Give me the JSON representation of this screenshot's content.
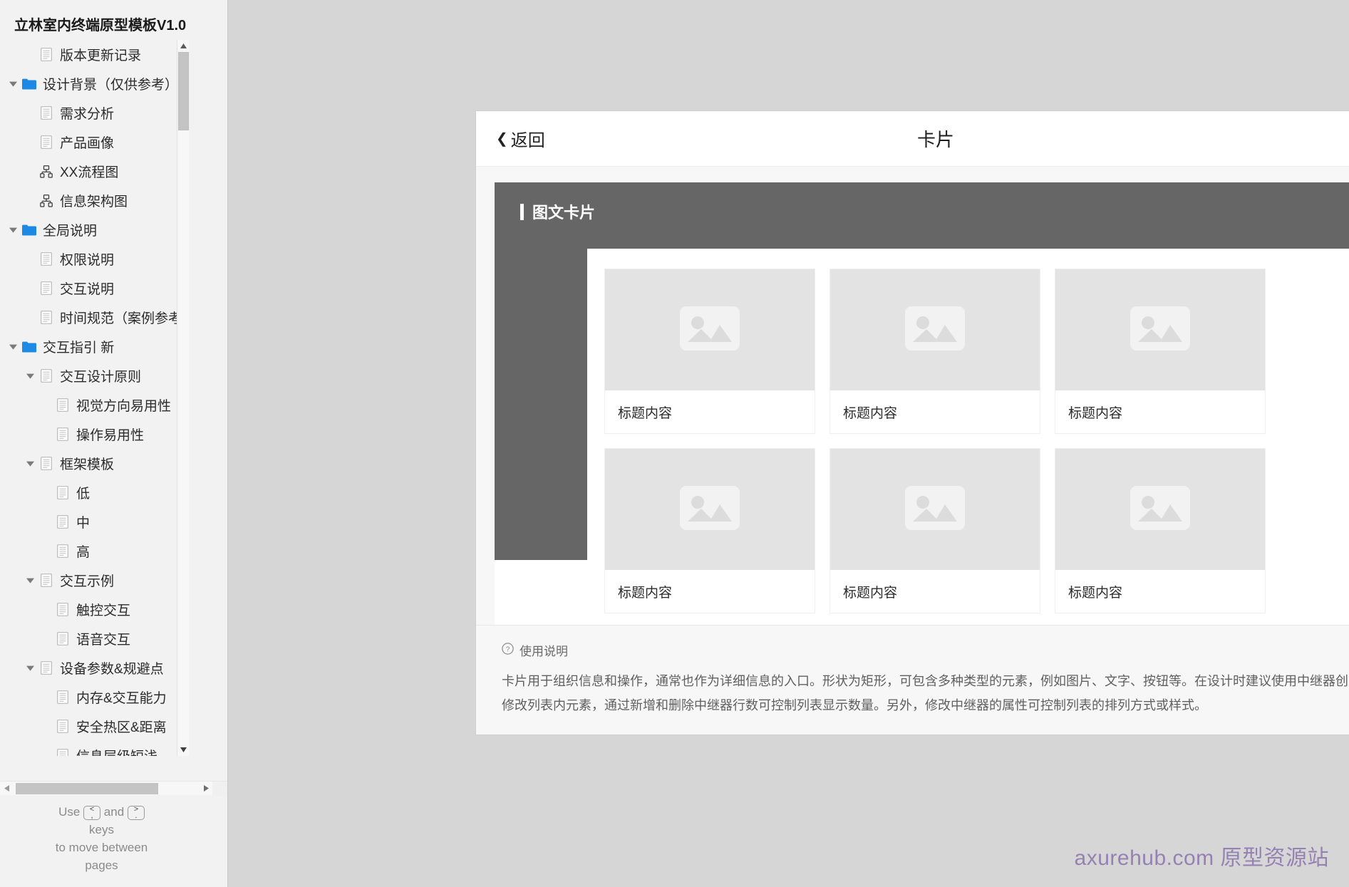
{
  "sidebar": {
    "title": "立林室内终端原型模板V1.0",
    "tree": [
      {
        "level": 1,
        "icon": "page-icon",
        "caret": "none",
        "label": "版本更新记录"
      },
      {
        "level": 0,
        "icon": "folder-icon",
        "caret": "expanded",
        "label": "设计背景（仅供参考）"
      },
      {
        "level": 1,
        "icon": "page-icon",
        "caret": "none",
        "label": "需求分析"
      },
      {
        "level": 1,
        "icon": "page-icon",
        "caret": "none",
        "label": "产品画像"
      },
      {
        "level": 1,
        "icon": "flow-icon",
        "caret": "none",
        "label": "XX流程图"
      },
      {
        "level": 1,
        "icon": "flow-icon",
        "caret": "none",
        "label": "信息架构图"
      },
      {
        "level": 0,
        "icon": "folder-icon",
        "caret": "expanded",
        "label": "全局说明"
      },
      {
        "level": 1,
        "icon": "page-icon",
        "caret": "none",
        "label": "权限说明"
      },
      {
        "level": 1,
        "icon": "page-icon",
        "caret": "none",
        "label": "交互说明"
      },
      {
        "level": 1,
        "icon": "page-icon",
        "caret": "none",
        "label": "时间规范（案例参考）"
      },
      {
        "level": 0,
        "icon": "folder-icon",
        "caret": "expanded",
        "label": "交互指引 新"
      },
      {
        "level": 1,
        "icon": "page-icon",
        "caret": "expanded",
        "label": "交互设计原则"
      },
      {
        "level": 2,
        "icon": "page-icon",
        "caret": "none",
        "label": "视觉方向易用性"
      },
      {
        "level": 2,
        "icon": "page-icon",
        "caret": "none",
        "label": "操作易用性"
      },
      {
        "level": 1,
        "icon": "page-icon",
        "caret": "expanded",
        "label": "框架模板"
      },
      {
        "level": 2,
        "icon": "page-icon",
        "caret": "none",
        "label": "低"
      },
      {
        "level": 2,
        "icon": "page-icon",
        "caret": "none",
        "label": "中"
      },
      {
        "level": 2,
        "icon": "page-icon",
        "caret": "none",
        "label": "高"
      },
      {
        "level": 1,
        "icon": "page-icon",
        "caret": "expanded",
        "label": "交互示例"
      },
      {
        "level": 2,
        "icon": "page-icon",
        "caret": "none",
        "label": "触控交互"
      },
      {
        "level": 2,
        "icon": "page-icon",
        "caret": "none",
        "label": "语音交互"
      },
      {
        "level": 1,
        "icon": "page-icon",
        "caret": "expanded",
        "label": "设备参数&规避点"
      },
      {
        "level": 2,
        "icon": "page-icon",
        "caret": "none",
        "label": "内存&交互能力"
      },
      {
        "level": 2,
        "icon": "page-icon",
        "caret": "none",
        "label": "安全热区&距离"
      },
      {
        "level": 2,
        "icon": "page-icon",
        "caret": "none",
        "label": "信息层级短浅"
      }
    ],
    "key_hint": {
      "use": "Use",
      "key_prev_top": "<",
      "key_prev_bottom": ",",
      "and": "and",
      "key_next_top": ">",
      "key_next_bottom": ".",
      "keys": "keys",
      "line3": "to move between",
      "line4": "pages"
    }
  },
  "device": {
    "back_label": "返回",
    "title": "卡片",
    "section_title": "图文卡片",
    "cards": [
      {
        "caption": "标题内容"
      },
      {
        "caption": "标题内容"
      },
      {
        "caption": "标题内容"
      },
      {
        "caption": "标题内容"
      },
      {
        "caption": "标题内容"
      },
      {
        "caption": "标题内容"
      }
    ],
    "usage": {
      "heading": "使用说明",
      "text": "卡片用于组织信息和操作，通常也作为详细信息的入口。形状为矩形，可包含多种类型的元素，例如图片、文字、按钮等。在设计时建议使用中继器创建或修改列表内元素，通过新增和删除中继器行数可控制列表显示数量。另外，修改中继器的属性可控制列表的排列方式或样式。"
    }
  },
  "watermark": "axurehub.com 原型资源站",
  "colors": {
    "accent_folder": "#1e88e5",
    "panel_gray": "#666666",
    "stage_bg": "#d6d6d6",
    "sidebar_bg": "#f2f2f2",
    "watermark": "#8b73ae"
  }
}
